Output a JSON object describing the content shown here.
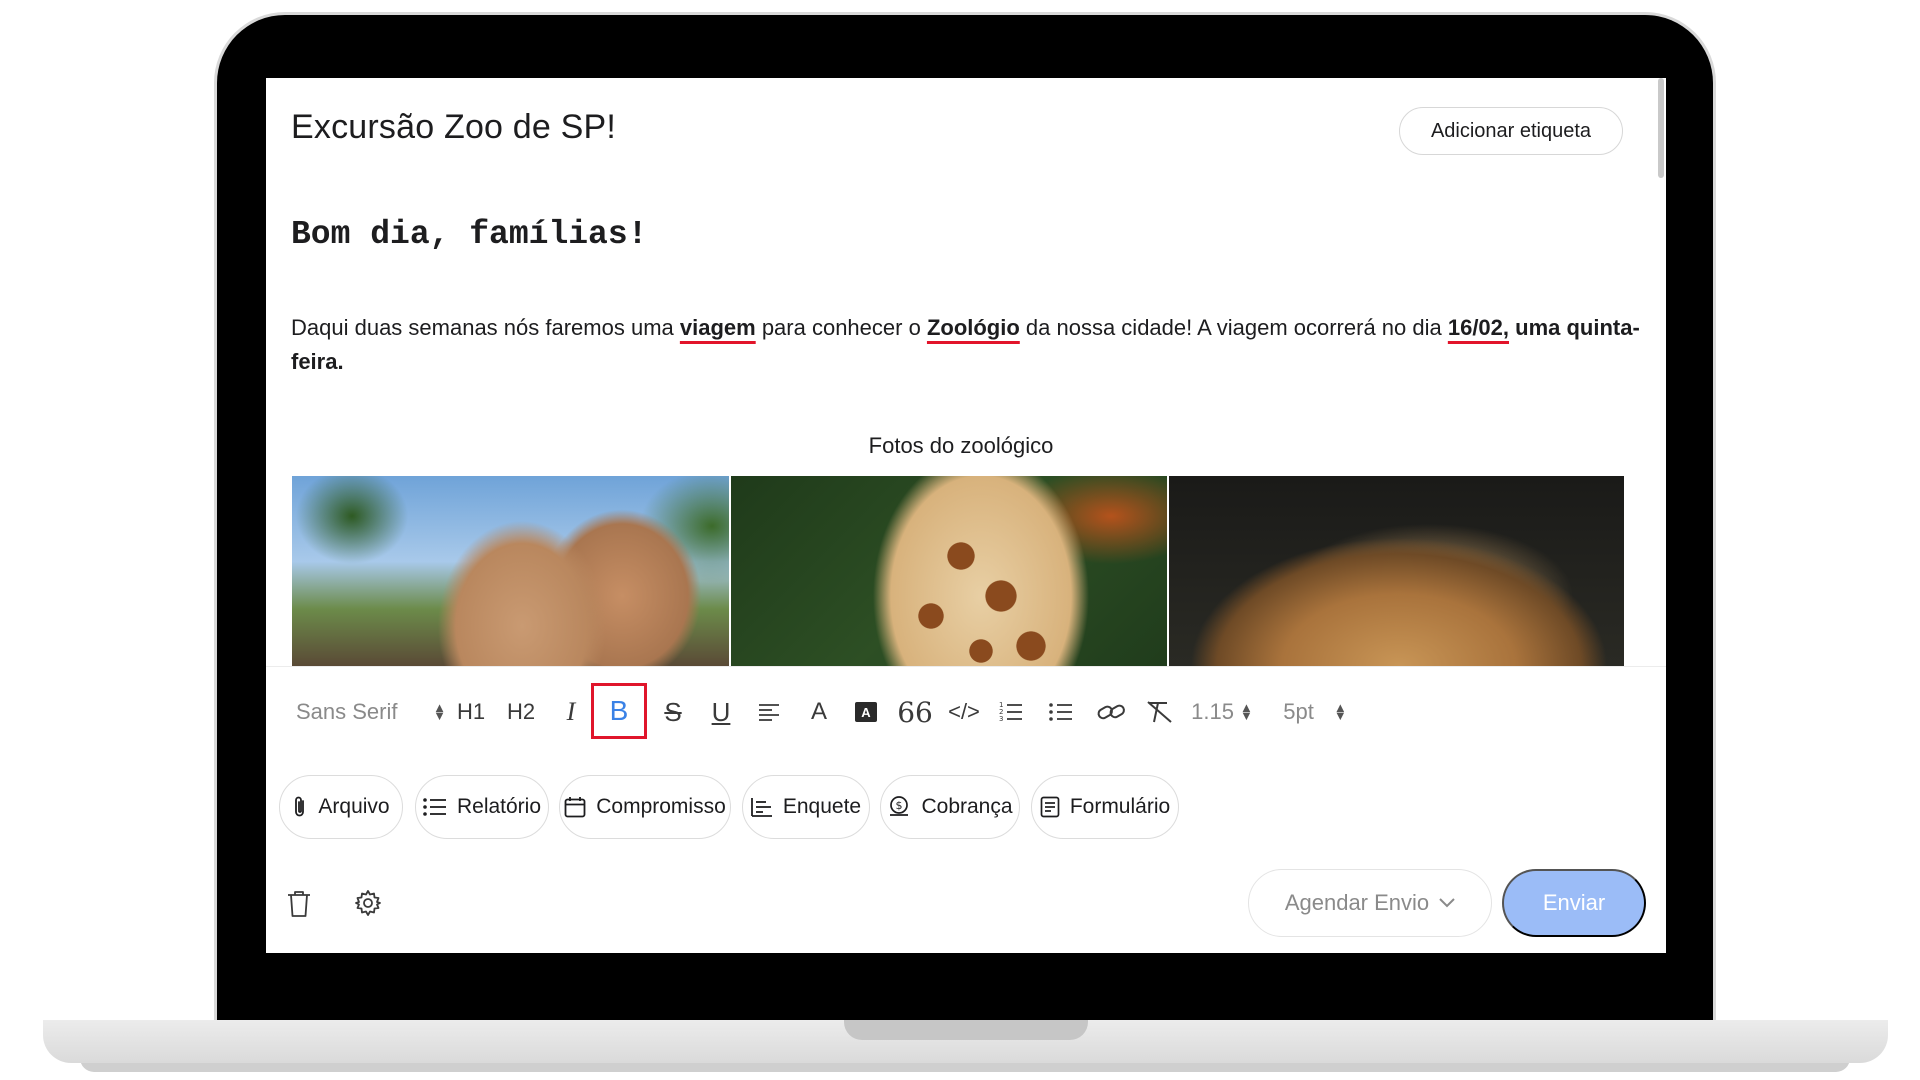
{
  "post": {
    "title": "Excursão Zoo de SP!",
    "add_tag_label": "Adicionar etiqueta",
    "greeting": "Bom dia, famílias!",
    "paragraph": {
      "p1": "Daqui duas semanas nós faremos uma ",
      "w1": "viagem",
      "p2": " para conhecer o ",
      "w2": "Zoológio",
      "p3": " da nossa cidade! A viagem ocorrerá no dia ",
      "w3": "16/02,",
      "p4": " uma quinta-feira."
    },
    "gallery_caption": "Fotos do zoológico"
  },
  "toolbar": {
    "font_family": "Sans Serif",
    "h1": "H1",
    "h2": "H2",
    "italic": "I",
    "bold": "B",
    "strikethrough": "S",
    "underline": "U",
    "font_color": "A",
    "bg_color": "A",
    "quote": "66",
    "code": "</>",
    "line_spacing": "1.15",
    "font_size": "5pt",
    "highlight_color": "#e0152b",
    "active_color": "#3a82e6"
  },
  "attachments": {
    "file": "Arquivo",
    "report": "Relatório",
    "appointment": "Compromisso",
    "poll": "Enquete",
    "charge": "Cobrança",
    "form": "Formulário"
  },
  "actions": {
    "schedule_label": "Agendar Envio",
    "send_label": "Enviar",
    "send_color": "#9bbcf7"
  }
}
